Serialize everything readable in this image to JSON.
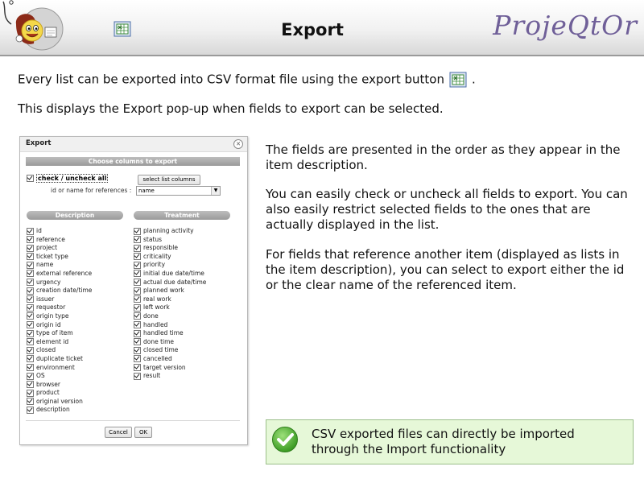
{
  "header": {
    "title": "Export",
    "brand": "ProjeQtOr",
    "export_icon": "export-csv-icon",
    "logo": "projeqtor-mascot-logo"
  },
  "intro": {
    "line1_before": "Every list can be exported into CSV format file using the export button",
    "line1_after": ".",
    "line2": "This displays the Export pop-up when fields to export can be selected."
  },
  "dialog": {
    "title": "Export",
    "choose_label": "Choose columns to export",
    "check_all_label": "check / uncheck all",
    "select_list_columns_label": "select list columns",
    "reference_label": "id or name for references :",
    "reference_value": "name",
    "description_header": "Description",
    "treatment_header": "Treatment",
    "description_fields": [
      "id",
      "reference",
      "project",
      "ticket type",
      "name",
      "external reference",
      "urgency",
      "creation date/time",
      "issuer",
      "requestor",
      "origin type",
      "origin id",
      "type of item",
      "element id",
      "closed",
      "duplicate ticket",
      "environment",
      "OS",
      "browser",
      "product",
      "original version",
      "description"
    ],
    "treatment_fields": [
      "planning activity",
      "status",
      "responsible",
      "criticality",
      "priority",
      "initial due date/time",
      "actual due date/time",
      "planned work",
      "real work",
      "left work",
      "done",
      "handled",
      "handled time",
      "done time",
      "closed time",
      "cancelled",
      "target version",
      "result"
    ],
    "cancel_label": "Cancel",
    "ok_label": "OK"
  },
  "paragraphs": {
    "p1": "The fields are presented in the order as they appear in the item description.",
    "p2": "You can easily check or uncheck all fields to export. You can also easily restrict selected fields to the ones that are actually displayed in the list.",
    "p3": "For fields that reference another item (displayed as lists in the item description), you can select to export either the id or the clear name of the referenced item."
  },
  "note": {
    "icon": "green-check-icon",
    "text_line1": "CSV exported files can directly be imported",
    "text_line2": "through the Import functionality"
  },
  "colors": {
    "brand": "#6f5f98",
    "note_bg": "#e6f8d8",
    "note_border": "#9bbf8a",
    "bar_gray": "#a8a8a8"
  }
}
